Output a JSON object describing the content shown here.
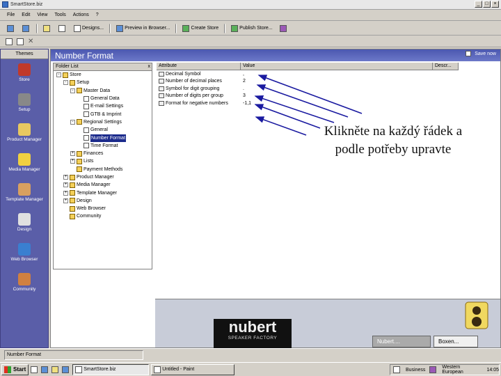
{
  "window": {
    "title": "SmartStore.biz",
    "buttons": [
      "_",
      "□",
      "×"
    ]
  },
  "menu": [
    "File",
    "Edit",
    "View",
    "Tools",
    "Actions",
    "?"
  ],
  "toolbar": {
    "buttons": [
      "Designs...",
      "Preview in Browser...",
      "Create Store",
      "Publish Store..."
    ]
  },
  "sidebar": {
    "header": "Themes",
    "items": [
      {
        "label": "Store",
        "icon": "store-icon",
        "color": "#c0392b"
      },
      {
        "label": "Setup",
        "icon": "setup-icon",
        "color": "#888888"
      },
      {
        "label": "Product Manager",
        "icon": "product-manager-icon",
        "color": "#e8c860"
      },
      {
        "label": "Media Manager",
        "icon": "media-manager-icon",
        "color": "#f0d040"
      },
      {
        "label": "Template Manager",
        "icon": "template-manager-icon",
        "color": "#d8a060"
      },
      {
        "label": "Design",
        "icon": "design-icon",
        "color": "#e0e0e0"
      },
      {
        "label": "Web Browser",
        "icon": "web-browser-icon",
        "color": "#3a7fd0"
      },
      {
        "label": "Community",
        "icon": "community-icon",
        "color": "#d08040"
      }
    ]
  },
  "panel": {
    "title": "Number Format",
    "save_all": "Save now"
  },
  "folder_list": {
    "header": "Folder List",
    "close": "x",
    "rows": [
      {
        "label": "Store",
        "indent": 0,
        "toggle": "-",
        "type": "folder"
      },
      {
        "label": "Setup",
        "indent": 1,
        "toggle": "-",
        "type": "folder"
      },
      {
        "label": "Master Data",
        "indent": 2,
        "toggle": "-",
        "type": "folder"
      },
      {
        "label": "General Data",
        "indent": 3,
        "toggle": "",
        "type": "page"
      },
      {
        "label": "E-mail Settings",
        "indent": 3,
        "toggle": "",
        "type": "page"
      },
      {
        "label": "GTB & Imprint",
        "indent": 3,
        "toggle": "",
        "type": "page"
      },
      {
        "label": "Regional Settings",
        "indent": 2,
        "toggle": "-",
        "type": "folder"
      },
      {
        "label": "General",
        "indent": 3,
        "toggle": "",
        "type": "page"
      },
      {
        "label": "Number Format",
        "indent": 3,
        "toggle": "",
        "type": "page",
        "selected": true
      },
      {
        "label": "Time Format",
        "indent": 3,
        "toggle": "",
        "type": "page"
      },
      {
        "label": "Finances",
        "indent": 2,
        "toggle": "+",
        "type": "folder"
      },
      {
        "label": "Lists",
        "indent": 2,
        "toggle": "+",
        "type": "folder"
      },
      {
        "label": "Payment Methods",
        "indent": 2,
        "toggle": "",
        "type": "folder"
      },
      {
        "label": "Product Manager",
        "indent": 1,
        "toggle": "+",
        "type": "folder"
      },
      {
        "label": "Media Manager",
        "indent": 1,
        "toggle": "+",
        "type": "folder"
      },
      {
        "label": "Template Manager",
        "indent": 1,
        "toggle": "+",
        "type": "folder"
      },
      {
        "label": "Design",
        "indent": 1,
        "toggle": "+",
        "type": "folder"
      },
      {
        "label": "Web Browser",
        "indent": 1,
        "toggle": "",
        "type": "folder"
      },
      {
        "label": "Community",
        "indent": 1,
        "toggle": "",
        "type": "folder"
      }
    ]
  },
  "grid": {
    "columns": [
      "Attribute",
      "Value",
      "Descr..."
    ],
    "rows": [
      {
        "attribute": "Decimal Symbol",
        "value": ","
      },
      {
        "attribute": "Number of decimal places",
        "value": "2"
      },
      {
        "attribute": "Symbol for digit grouping",
        "value": "."
      },
      {
        "attribute": "Number of digits per group",
        "value": "3"
      },
      {
        "attribute": "Format for negative numbers",
        "value": "-1,1"
      }
    ]
  },
  "ad": {
    "brand": "nubert",
    "tagline": "SPEAKER FACTORY",
    "tab1": "Nubert....",
    "tab2": "Boxen..."
  },
  "status": {
    "text": "Number Format"
  },
  "taskbar": {
    "start": "Start",
    "tasks": [
      "SmartStore.biz",
      "Untitled - Paint"
    ],
    "tray": [
      "Business",
      "Western European"
    ],
    "clock": "14:05"
  },
  "annotation": {
    "line1": "Klikněte na každý řádek a",
    "line2": "podle potřeby upravte"
  }
}
